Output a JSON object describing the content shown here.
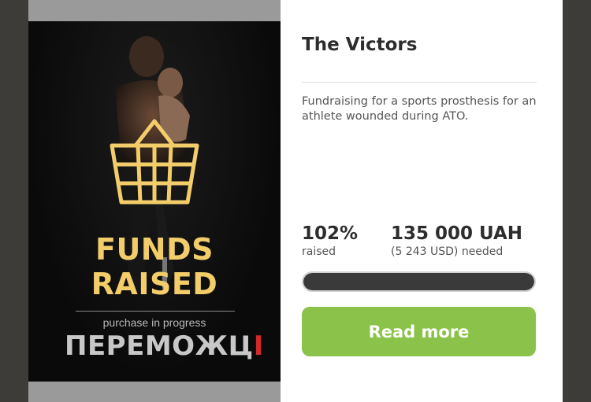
{
  "campaign": {
    "title": "The Victors",
    "description": "Fundraising for a sports prosthesis for an athlete wounded during ATO.",
    "percent": "102%",
    "percent_label": "raised",
    "percent_value": 1.02,
    "amount": "135 000 UAH",
    "amount_label": "(5 243 USD) needed",
    "read_more_label": "Read more"
  },
  "poster": {
    "headline_line1": "FUNDS",
    "headline_line2": "RAISED",
    "subtitle": "purchase in progress",
    "logo_main": "ПЕРЕМОЖЦ",
    "logo_accent": "І",
    "icon": "shopping-basket-icon"
  },
  "colors": {
    "accent_green": "#8bc34a",
    "poster_gold": "#f2cd6a",
    "progress_fill": "#3a3a3a",
    "logo_red": "#d02a2a"
  }
}
